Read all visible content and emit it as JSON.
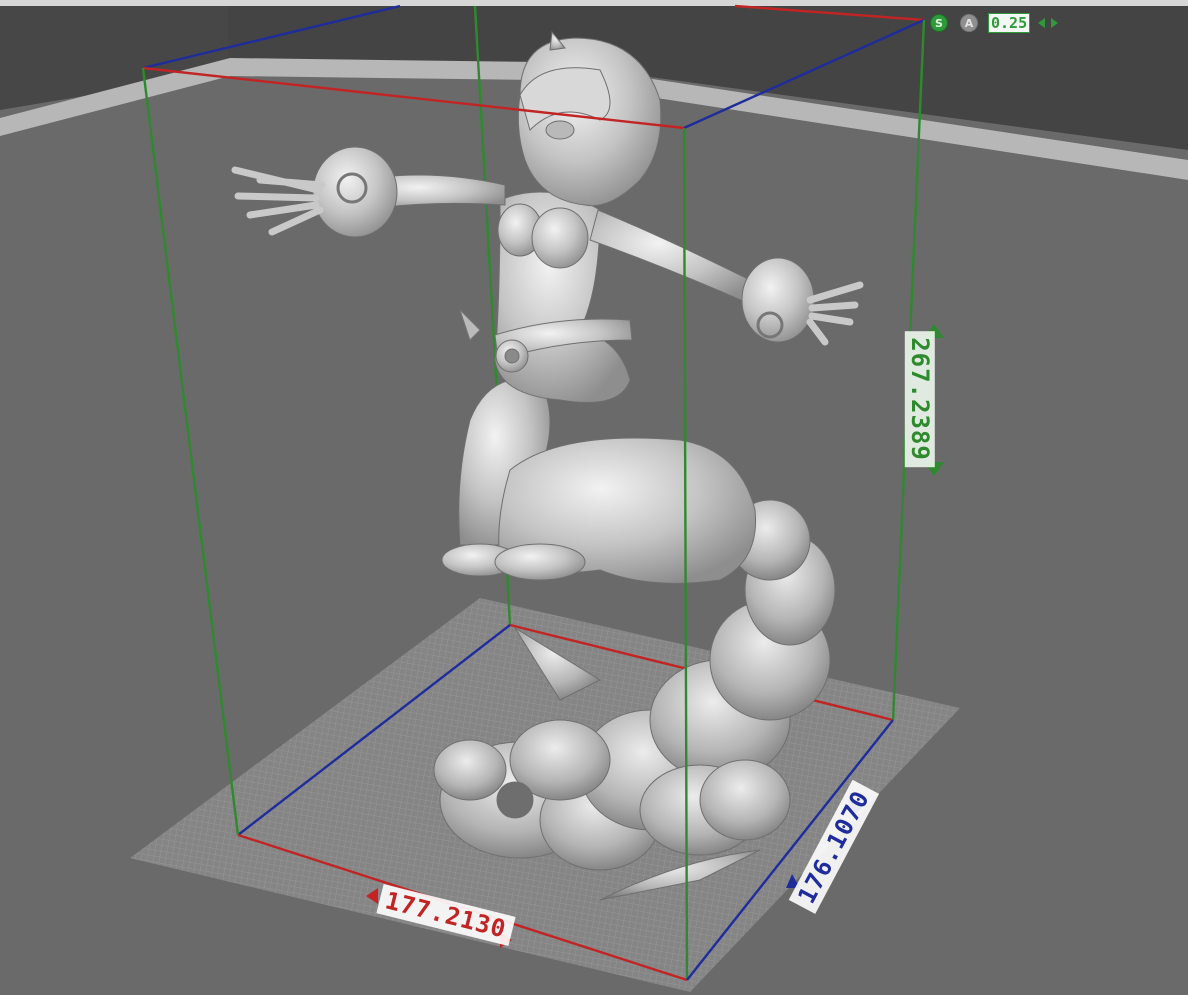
{
  "toolbar": {
    "snap_label": "S",
    "auto_label": "A",
    "increment_value": "0.25"
  },
  "dimensions": {
    "x": "177.2130",
    "y": "176.1070",
    "z": "267.2389"
  },
  "icons": {
    "snap_toggle": "snap-icon",
    "auto_toggle": "auto-icon",
    "decrease": "left-arrow-icon",
    "increase": "right-arrow-icon"
  },
  "colors": {
    "background": "#6b6b6b",
    "axis_x": "#c22424",
    "axis_y": "#1f2c9c",
    "axis_z": "#2f8a2f",
    "model": "#bfbfbf"
  }
}
